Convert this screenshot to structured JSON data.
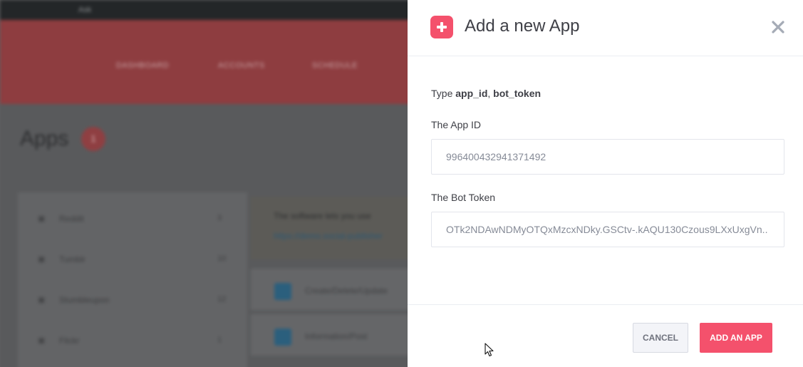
{
  "background": {
    "topbar_text": "Ask",
    "nav": [
      "DASHBOARD",
      "ACCOUNTS",
      "SCHEDULE"
    ],
    "page_title": "Apps",
    "page_badge": "1",
    "sidebar": [
      {
        "label": "Reddit",
        "count": "3"
      },
      {
        "label": "Tumblr",
        "count": "10"
      },
      {
        "label": "Stumbleupon",
        "count": "12"
      },
      {
        "label": "Flickr",
        "count": "1"
      }
    ],
    "info_line1": "The software lets you use",
    "info_line2": "https://demo.social-publisher",
    "rows": [
      "Create/Delete/Update",
      "Information/Post"
    ]
  },
  "modal": {
    "title": "Add a new App",
    "type_prefix": "Type ",
    "type_field1": "app_id",
    "type_sep": ", ",
    "type_field2": "bot_token",
    "app_id_label": "The App ID",
    "app_id_value": "996400432941371492",
    "bot_token_label": "The Bot Token",
    "bot_token_value": "OTk2NDAwNDMyOTQxMzcxNDky.GSCtv-.kAQU130Czous9LXxUxgVn..",
    "cancel_label": "CANCEL",
    "submit_label": "ADD AN APP"
  },
  "colors": {
    "accent": "#f4516c",
    "text": "#3f4047",
    "input_text": "#868b97"
  },
  "icons": {
    "header_icon": "plus-icon",
    "close": "close-icon"
  }
}
